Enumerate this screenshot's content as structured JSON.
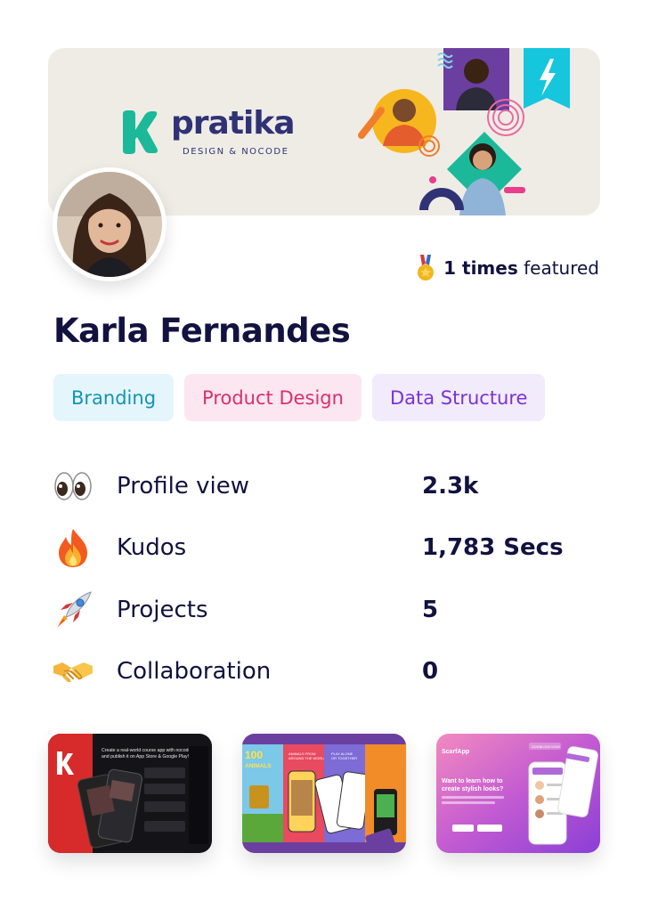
{
  "banner": {
    "brand_name": "pratika",
    "brand_tagline": "DESIGN & NOCODE"
  },
  "profile": {
    "name": "Karla Fernandes",
    "featured_count": "1 times",
    "featured_suffix": "featured"
  },
  "tags": [
    {
      "label": "Branding",
      "color": "#1392b8",
      "bg": "#e4f6fb"
    },
    {
      "label": "Product Design",
      "color": "#d8306f",
      "bg": "#fce6ef"
    },
    {
      "label": "Data Structure",
      "color": "#7a33d6",
      "bg": "#f1ebfc"
    }
  ],
  "stats": [
    {
      "icon": "eyes-icon",
      "label": "Profile view",
      "value": "2.3k"
    },
    {
      "icon": "fire-icon",
      "label": "Kudos",
      "value": "1,783 Secs"
    },
    {
      "icon": "rocket-icon",
      "label": "Projects",
      "value": "5"
    },
    {
      "icon": "handshake-icon",
      "label": "Collaboration",
      "value": "0"
    }
  ],
  "projects": [
    {
      "icon": "project-thumbnail-nocode-course",
      "caption": "Create a real-world course app with nocode and publish it on App Store & Google Play!"
    },
    {
      "icon": "project-thumbnail-100-animals",
      "title": "100 ANIMALS",
      "caption_1": "ANIMALS FROM AROUND THE WORLD",
      "caption_2": "PLAY ALONE OR TOGETHER"
    },
    {
      "icon": "project-thumbnail-scarfapp",
      "app_name": "ScarfApp",
      "headline": "Want to learn how to create stylish looks?",
      "badge": "DOWNLOAD NOW!"
    }
  ],
  "colors": {
    "text": "#11123f",
    "brand": "#2f3275",
    "brand_accent": "#1bb99a"
  }
}
